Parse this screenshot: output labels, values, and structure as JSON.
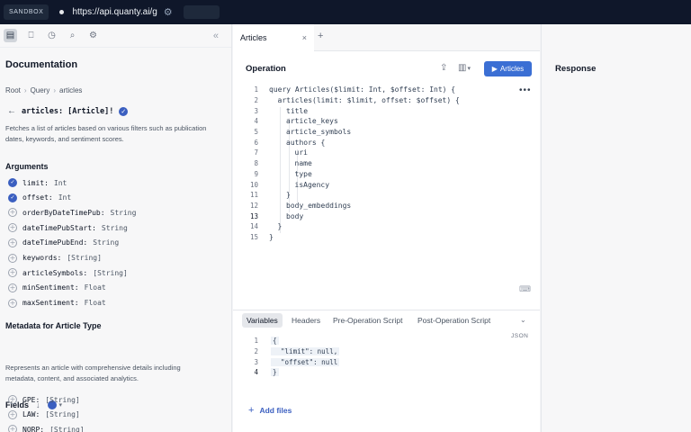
{
  "topbar": {
    "sandbox_label": "SANDBOX",
    "url": "https://api.quanty.ai/g"
  },
  "sidebar": {
    "title": "Documentation",
    "breadcrumb": [
      "Root",
      "Query",
      "articles"
    ],
    "field_signature": "articles: [Article]!",
    "field_description": "Fetches a list of articles based on various filters such as publication dates, keywords, and sentiment scores.",
    "arguments_title": "Arguments",
    "arguments": [
      {
        "name": "limit:",
        "type": "Int",
        "selected": true
      },
      {
        "name": "offset:",
        "type": "Int",
        "selected": true
      },
      {
        "name": "orderByDateTimePub:",
        "type": "String",
        "selected": false
      },
      {
        "name": "dateTimePubStart:",
        "type": "String",
        "selected": false
      },
      {
        "name": "dateTimePubEnd:",
        "type": "String",
        "selected": false
      },
      {
        "name": "keywords:",
        "type": "[String]",
        "selected": false
      },
      {
        "name": "articleSymbols:",
        "type": "[String]",
        "selected": false
      },
      {
        "name": "minSentiment:",
        "type": "Float",
        "selected": false
      },
      {
        "name": "maxSentiment:",
        "type": "Float",
        "selected": false
      }
    ],
    "metadata_title": "Metadata for Article Type",
    "metadata_description": "Represents an article with comprehensive details including metadata, content, and associated analytics.",
    "fields_title": "Fields",
    "fields": [
      {
        "name": "GPE:",
        "type": "[String]"
      },
      {
        "name": "LAW:",
        "type": "[String]"
      },
      {
        "name": "NORP:",
        "type": "[String]"
      }
    ]
  },
  "editor": {
    "tab_label": "Articles",
    "tab_close": "×",
    "tab_add": "+",
    "operation_title": "Operation",
    "run_button_label": "Articles",
    "code_lines": [
      {
        "n": "1",
        "indent": 0,
        "text": "query Articles($limit: Int, $offset: Int) {"
      },
      {
        "n": "2",
        "indent": 1,
        "text": "articles(limit: $limit, offset: $offset) {"
      },
      {
        "n": "3",
        "indent": 2,
        "text": "title"
      },
      {
        "n": "4",
        "indent": 2,
        "text": "article_keys"
      },
      {
        "n": "5",
        "indent": 2,
        "text": "article_symbols"
      },
      {
        "n": "6",
        "indent": 2,
        "text": "authors {"
      },
      {
        "n": "7",
        "indent": 3,
        "text": "uri"
      },
      {
        "n": "8",
        "indent": 3,
        "text": "name"
      },
      {
        "n": "9",
        "indent": 3,
        "text": "type"
      },
      {
        "n": "10",
        "indent": 3,
        "text": "isAgency"
      },
      {
        "n": "11",
        "indent": 2,
        "text": "}"
      },
      {
        "n": "12",
        "indent": 2,
        "text": "body_embeddings"
      },
      {
        "n": "13",
        "indent": 2,
        "text": "body"
      },
      {
        "n": "14",
        "indent": 1,
        "text": "}"
      },
      {
        "n": "15",
        "indent": 0,
        "text": "}"
      }
    ],
    "variables_tabs": [
      "Variables",
      "Headers",
      "Pre-Operation Script",
      "Post-Operation Script"
    ],
    "json_label": "JSON",
    "variables_lines": [
      {
        "n": "1",
        "text": "{"
      },
      {
        "n": "2",
        "text": "  \"limit\": null,"
      },
      {
        "n": "3",
        "text": "  \"offset\": null"
      },
      {
        "n": "4",
        "text": "}"
      }
    ],
    "add_files_label": "Add files"
  },
  "response": {
    "title": "Response"
  }
}
